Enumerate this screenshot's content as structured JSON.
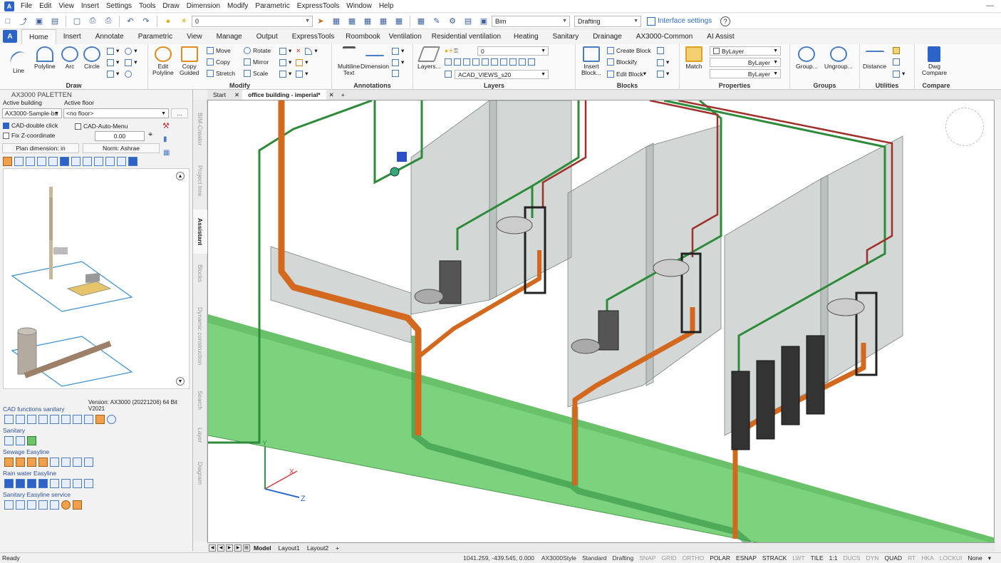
{
  "menubar": {
    "app_icon": "A",
    "items": [
      "File",
      "Edit",
      "View",
      "Insert",
      "Settings",
      "Tools",
      "Draw",
      "Dimension",
      "Modify",
      "Parametric",
      "ExpressTools",
      "Window",
      "Help"
    ]
  },
  "qat": {
    "layer_value": "0",
    "workspace_bim": "Bim",
    "workspace_mode": "Drafting",
    "interface_settings": "Interface settings"
  },
  "tabs": {
    "items": [
      "Home",
      "Insert",
      "Annotate",
      "Parametric",
      "View",
      "Manage",
      "Output",
      "ExpressTools",
      "Roombook",
      "Ventilation",
      "Residential ventilation",
      "Heating",
      "Sanitary",
      "Drainage",
      "AX3000-Common",
      "AI Assist"
    ],
    "active": "Home"
  },
  "ribbon": {
    "draw": {
      "title": "Draw",
      "line": "Line",
      "polyline": "Polyline",
      "arc": "Arc",
      "circle": "Circle"
    },
    "modify": {
      "title": "Modify",
      "edit_polyline_1": "Edit",
      "edit_polyline_2": "Polyline",
      "copy_guided_1": "Copy",
      "copy_guided_2": "Guided",
      "move": "Move",
      "rotate": "Rotate",
      "copy": "Copy",
      "mirror": "Mirror",
      "stretch": "Stretch",
      "scale": "Scale"
    },
    "annotations": {
      "title": "Annotations",
      "multiline_1": "Multiline",
      "multiline_2": "Text",
      "dimension": "Dimension"
    },
    "layers": {
      "title": "Layers",
      "layers_btn": "Layers...",
      "layer_value": "0",
      "layer_current": "ACAD_VIEWS_s20"
    },
    "blocks": {
      "title": "Blocks",
      "insert_1": "Insert",
      "insert_2": "Block...",
      "create_block": "Create Block",
      "blockify": "Blockify",
      "edit_block": "Edit Block"
    },
    "properties": {
      "title": "Properties",
      "match": "Match",
      "color": "ByLayer",
      "linetype": "ByLayer",
      "lineweight": "ByLayer"
    },
    "groups": {
      "title": "Groups",
      "group": "Group...",
      "ungroup": "Ungroup..."
    },
    "utilities": {
      "title": "Utilities",
      "distance": "Distance"
    },
    "compare": {
      "title": "Compare",
      "dwg_1": "Dwg",
      "dwg_2": "Compare"
    }
  },
  "palette": {
    "title": "AX3000 PALETTEN",
    "active_building_label": "Active building",
    "active_floor_label": "Active floor",
    "building_value": "AX3000-Sample-bu",
    "floor_value": "<no floor>",
    "more_btn": "...",
    "cad_double_click": "CAD-double click",
    "cad_auto_menu": "CAD-Auto-Menu",
    "fix_z": "Fix Z-coordinate",
    "z_value": "0.00",
    "plan_dimension": "Plan dimension: in",
    "norm": "Norm: Ashrae",
    "version": "Version: AX3000 (20221206) 64 Bit V2021",
    "sections": {
      "cad_functions": "CAD functions sanitary",
      "sanitary": "Sanitary",
      "sewage": "Sewage Easyline",
      "rain": "Rain water Easyline",
      "service": "Sanitary Easyline service"
    }
  },
  "sidetabs": [
    "BIM-Creator",
    "Project tree",
    "Assistant",
    "Blocks",
    "Dynamic construction",
    "Search",
    "Layer",
    "Diagram"
  ],
  "doctabs": {
    "start": "Start",
    "active": "office building - imperial*",
    "add": "+"
  },
  "canvas": {
    "axis_y": "Y",
    "axis_x": "X",
    "axis_z": "Z"
  },
  "layout_tabs": {
    "model": "Model",
    "layout1": "Layout1",
    "layout2": "Layout2",
    "add": "+"
  },
  "status": {
    "ready": "Ready",
    "coords": "1041.259, -439.545, 0.000",
    "style": "AX3000Style",
    "standard": "Standard",
    "drafting": "Drafting",
    "toggles": [
      "SNAP",
      "GRID",
      "ORTHO",
      "POLAR",
      "ESNAP",
      "STRACK",
      "LWT",
      "TILE",
      "1:1",
      "DUCS",
      "DYN",
      "QUAD",
      "RT",
      "HKA",
      "LOCKUI",
      "None"
    ]
  },
  "colors": {
    "accent": "#2b63c9",
    "pipe_orange": "#d2691e",
    "pipe_green": "#2e8b3a",
    "pipe_red": "#a52a2a",
    "floor_green": "#6fcf6f",
    "wall_gray": "#9aa0a0"
  }
}
